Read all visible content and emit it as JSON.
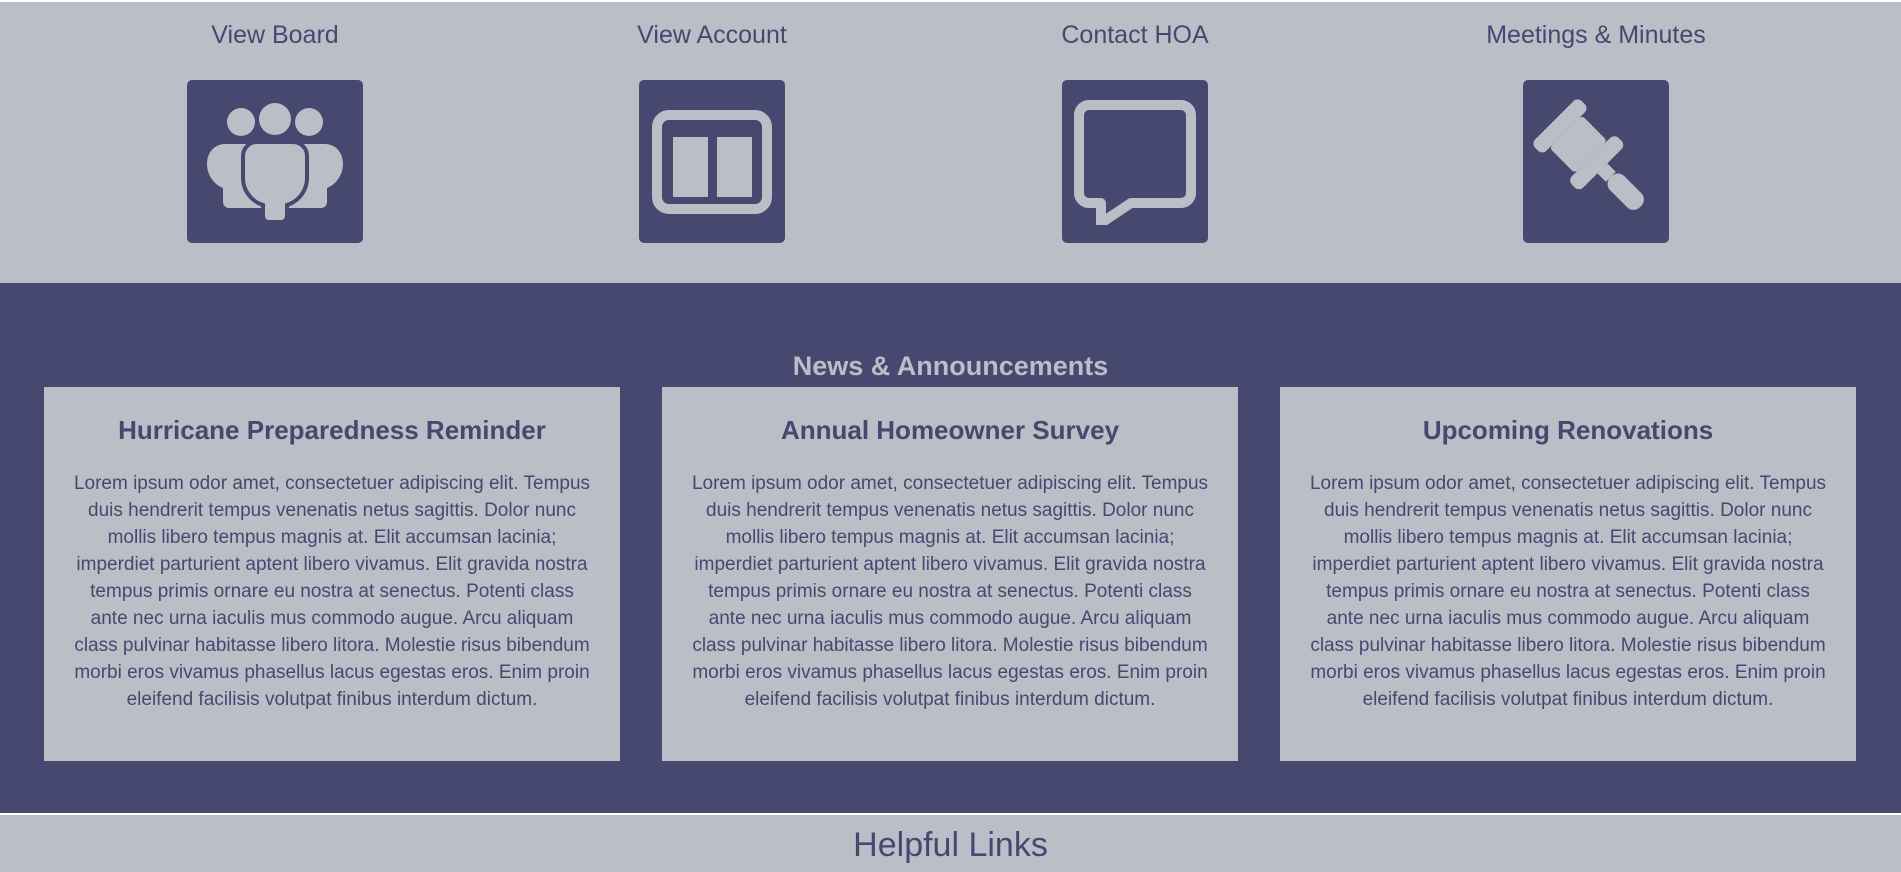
{
  "colors": {
    "accent": "#474870",
    "light": "#babec6"
  },
  "quick_links": [
    {
      "label": "View Board",
      "icon": "users-icon"
    },
    {
      "label": "View Account",
      "icon": "columns-icon"
    },
    {
      "label": "Contact HOA",
      "icon": "chat-bubble-icon"
    },
    {
      "label": "Meetings & Minutes",
      "icon": "gavel-icon"
    }
  ],
  "news": {
    "title": "News & Announcements",
    "cards": [
      {
        "title": "Hurricane Preparedness Reminder",
        "body": "Lorem ipsum odor amet, consectetuer adipiscing elit. Tempus duis hendrerit tempus venenatis netus sagittis. Dolor nunc mollis libero tempus magnis at. Elit accumsan lacinia; imperdiet parturient aptent libero vivamus. Elit gravida nostra tempus primis ornare eu nostra at senectus. Potenti class ante nec urna iaculis mus commodo augue. Arcu aliquam class pulvinar habitasse libero litora. Molestie risus bibendum morbi eros vivamus phasellus lacus egestas eros. Enim proin eleifend facilisis volutpat finibus interdum dictum."
      },
      {
        "title": "Annual Homeowner Survey",
        "body": "Lorem ipsum odor amet, consectetuer adipiscing elit. Tempus duis hendrerit tempus venenatis netus sagittis. Dolor nunc mollis libero tempus magnis at. Elit accumsan lacinia; imperdiet parturient aptent libero vivamus. Elit gravida nostra tempus primis ornare eu nostra at senectus. Potenti class ante nec urna iaculis mus commodo augue. Arcu aliquam class pulvinar habitasse libero litora. Molestie risus bibendum morbi eros vivamus phasellus lacus egestas eros. Enim proin eleifend facilisis volutpat finibus interdum dictum."
      },
      {
        "title": "Upcoming Renovations",
        "body": "Lorem ipsum odor amet, consectetuer adipiscing elit. Tempus duis hendrerit tempus venenatis netus sagittis. Dolor nunc mollis libero tempus magnis at. Elit accumsan lacinia; imperdiet parturient aptent libero vivamus. Elit gravida nostra tempus primis ornare eu nostra at senectus. Potenti class ante nec urna iaculis mus commodo augue. Arcu aliquam class pulvinar habitasse libero litora. Molestie risus bibendum morbi eros vivamus phasellus lacus egestas eros. Enim proin eleifend facilisis volutpat finibus interdum dictum."
      }
    ]
  },
  "helpful_links": {
    "title": "Helpful Links"
  }
}
